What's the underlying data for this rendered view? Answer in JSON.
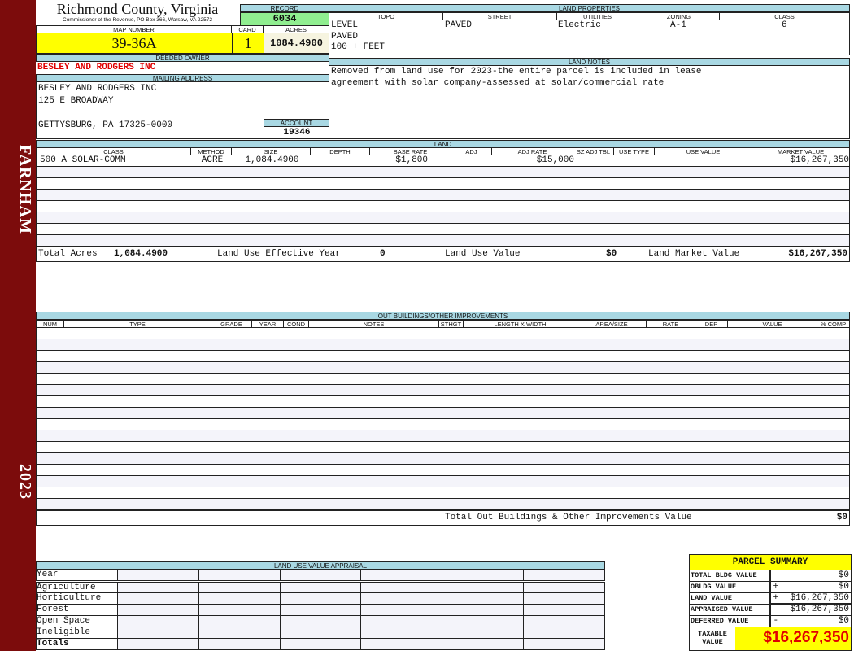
{
  "sidebar": {
    "district": "FARNHAM",
    "year": "2023"
  },
  "header": {
    "county": "Richmond County, Virginia",
    "subtitle": "Commissioner of the Revenue, PO Box 366, Warsaw, VA 22572"
  },
  "record": {
    "label": "RECORD",
    "value": "6034"
  },
  "map": {
    "label": "MAP NUMBER",
    "value": "39-36A"
  },
  "card": {
    "label": "CARD",
    "value": "1"
  },
  "acres": {
    "label": "ACRES",
    "value": "1084.4900"
  },
  "land_properties": {
    "title": "LAND PROPERTIES",
    "columns": [
      "TOPO",
      "STREET",
      "UTILITIES",
      "ZONING",
      "CLASS"
    ],
    "topo": [
      "LEVEL",
      "PAVED",
      "100 + FEET"
    ],
    "street": "PAVED",
    "utilities": "Electric",
    "zoning": "A-1",
    "class": "6"
  },
  "owner": {
    "label": "DEEDED OWNER",
    "value": "BESLEY AND RODGERS INC"
  },
  "mailing": {
    "label": "MAILING ADDRESS",
    "lines": [
      "BESLEY AND RODGERS INC",
      "125 E BROADWAY",
      "",
      "GETTYSBURG, PA 17325-0000"
    ]
  },
  "account": {
    "label": "ACCOUNT",
    "value": "19346"
  },
  "land_notes": {
    "title": "LAND NOTES",
    "lines": [
      "Removed from land use for 2023-the entire parcel is included in lease",
      "agreement with solar company-assessed at solar/commercial rate"
    ]
  },
  "land": {
    "title": "LAND",
    "columns": [
      "CLASS",
      "METHOD",
      "SIZE",
      "DEPTH",
      "BASE RATE",
      "ADJ",
      "ADJ RATE",
      "SZ ADJ TBL",
      "USE TYPE",
      "USE VALUE",
      "MARKET VALUE"
    ],
    "rows": [
      [
        "500 A SOLAR-COMM",
        "ACRE",
        "1,084.4900",
        "",
        "$1,800",
        "",
        "$15,000",
        "",
        "",
        "",
        "$16,267,350"
      ]
    ],
    "totals": {
      "acres_label": "Total Acres",
      "acres": "1,084.4900",
      "eff_year_label": "Land Use Effective Year",
      "eff_year": "0",
      "use_value_label": "Land Use Value",
      "use_value": "$0",
      "market_label": "Land Market Value",
      "market": "$16,267,350"
    }
  },
  "outbuildings": {
    "title": "OUT BUILDINGS/OTHER IMPROVEMENTS",
    "columns": [
      "NUM",
      "TYPE",
      "GRADE",
      "YEAR",
      "COND",
      "NOTES",
      "STHGT",
      "LENGTH X WIDTH",
      "AREA/SIZE",
      "RATE",
      "DEP",
      "VALUE",
      "% COMP"
    ],
    "total_label": "Total Out Buildings & Other Improvements Value",
    "total": "$0"
  },
  "land_use_appraisal": {
    "title": "LAND USE VALUE APPRAISAL",
    "rows": [
      "Year",
      "Agriculture",
      "Horticulture",
      "Forest",
      "Open Space",
      "Ineligible",
      "Totals"
    ]
  },
  "parcel_summary": {
    "title": "PARCEL SUMMARY",
    "rows": [
      {
        "label": "TOTAL BLDG VALUE",
        "sign": "",
        "value": "$0"
      },
      {
        "label": "OBLDG VALUE",
        "sign": "+",
        "value": "$0"
      },
      {
        "label": "LAND VALUE",
        "sign": "+",
        "value": "$16,267,350"
      },
      {
        "label": "APPRAISED VALUE",
        "sign": "",
        "value": "$16,267,350"
      },
      {
        "label": "DEFERRED VALUE",
        "sign": "-",
        "value": "$0"
      }
    ],
    "taxable_label": "TAXABLE VALUE",
    "taxable": "$16,267,350"
  },
  "colors": {
    "sidebar": "#7c0c0c",
    "header_blue": "#a9d8e3",
    "record_green": "#90ee90",
    "highlight_yellow": "#ffff00",
    "owner_red": "#e00000"
  }
}
